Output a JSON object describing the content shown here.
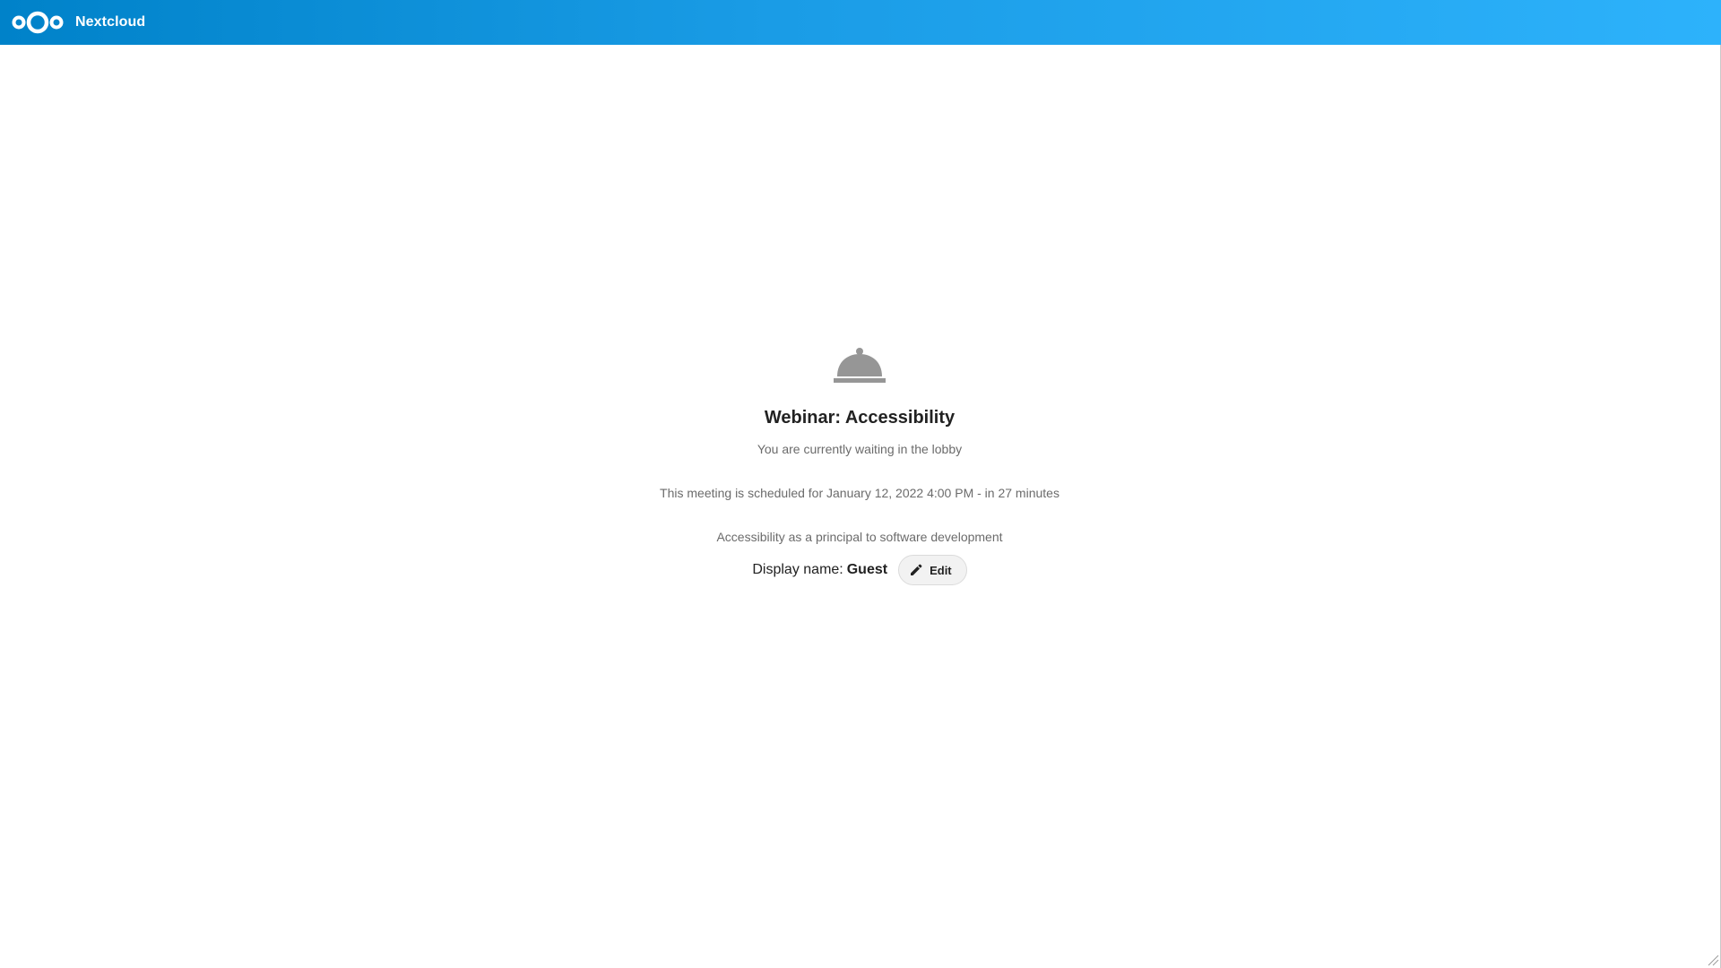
{
  "header": {
    "brand": "Nextcloud",
    "logo_icon": "nextcloud-logo-icon",
    "gradient_start": "#0082c9",
    "gradient_end": "#2db2fb"
  },
  "lobby": {
    "icon": "lobby-bell-icon",
    "title": "Webinar: Accessibility",
    "subtitle": "You are currently waiting in the lobby",
    "schedule": "This meeting is scheduled for January 12, 2022 4:00 PM - in 27 minutes",
    "description": "Accessibility as a principal to software development",
    "display_name_label": "Display name:",
    "display_name_value": "Guest",
    "edit_label": "Edit",
    "edit_icon": "pencil-icon"
  }
}
